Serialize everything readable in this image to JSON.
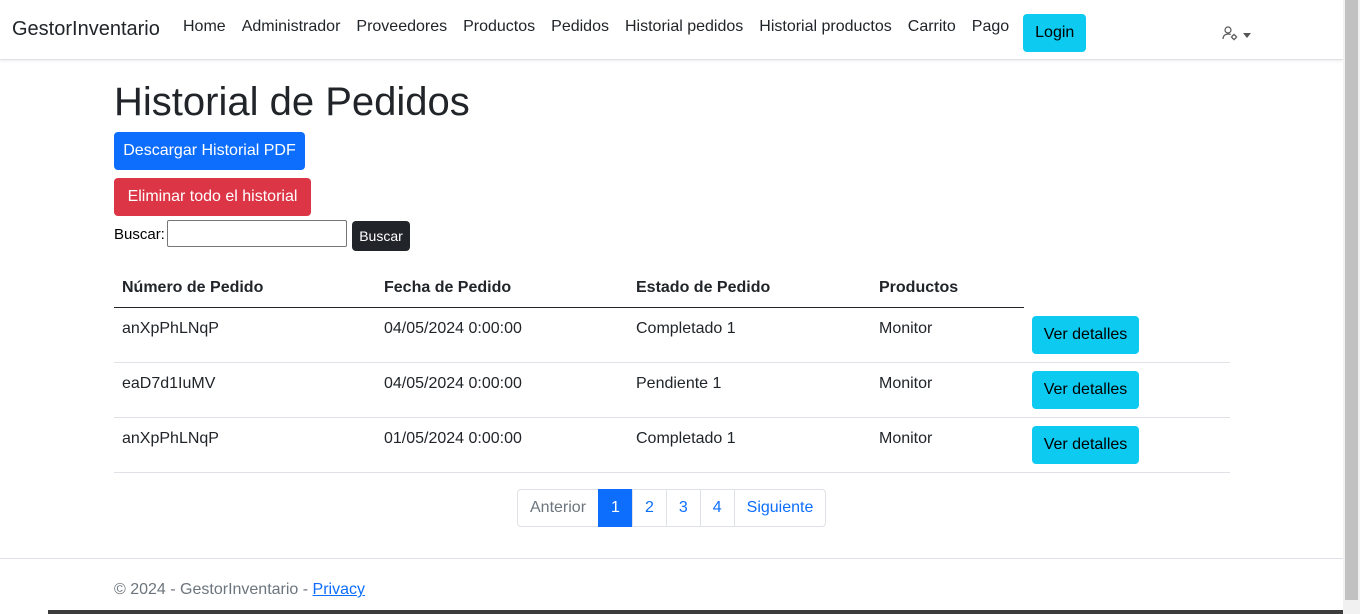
{
  "navbar": {
    "brand": "GestorInventario",
    "links": [
      "Home",
      "Administrador",
      "Proveedores",
      "Productos",
      "Pedidos",
      "Historial pedidos",
      "Historial productos",
      "Carrito",
      "Pago"
    ],
    "login_label": "Login",
    "user_icon": "user-gear-icon"
  },
  "page": {
    "title": "Historial de Pedidos",
    "download_pdf_label": "Descargar Historial PDF",
    "delete_all_label": "Eliminar todo el historial"
  },
  "search": {
    "label": "Buscar:",
    "value": "",
    "button_label": "Buscar"
  },
  "table": {
    "headers": [
      "Número de Pedido",
      "Fecha de Pedido",
      "Estado de Pedido",
      "Productos"
    ],
    "rows": [
      {
        "numero": "anXpPhLNqP",
        "fecha": "04/05/2024 0:00:00",
        "estado": "Completado 1",
        "productos": "Monitor",
        "action": "Ver detalles"
      },
      {
        "numero": "eaD7d1IuMV",
        "fecha": "04/05/2024 0:00:00",
        "estado": "Pendiente 1",
        "productos": "Monitor",
        "action": "Ver detalles"
      },
      {
        "numero": "anXpPhLNqP",
        "fecha": "01/05/2024 0:00:00",
        "estado": "Completado 1",
        "productos": "Monitor",
        "action": "Ver detalles"
      }
    ]
  },
  "pagination": {
    "previous": "Anterior",
    "pages": [
      "1",
      "2",
      "3",
      "4"
    ],
    "active": "1",
    "next": "Siguiente"
  },
  "footer": {
    "text": "© 2024 - GestorInventario - ",
    "link": "Privacy"
  },
  "colors": {
    "primary": "#0d6efd",
    "danger": "#dc3545",
    "info": "#0dcaf0",
    "dark": "#212529"
  }
}
